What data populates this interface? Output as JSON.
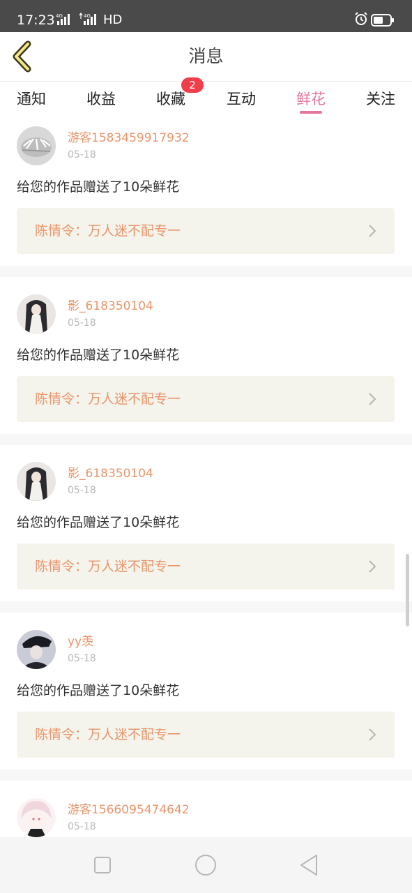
{
  "status_bar": {
    "time": "17:23",
    "network_1": "4G",
    "network_2": "4G",
    "hd": "HD",
    "icons": [
      "signal-icon",
      "signal-icon",
      "alarm-clock-icon",
      "battery-icon"
    ]
  },
  "header": {
    "title": "消息",
    "back_icon": "chevron-left-icon",
    "back_color": "#3a3a1a"
  },
  "tabs": [
    {
      "label": "通知",
      "active": false
    },
    {
      "label": "收益",
      "active": false
    },
    {
      "label": "收藏",
      "active": false,
      "badge": "2"
    },
    {
      "label": "互动",
      "active": false
    },
    {
      "label": "鲜花",
      "active": true
    },
    {
      "label": "关注",
      "active": false
    }
  ],
  "colors": {
    "accent": "#e4769e",
    "username": "#e9956b",
    "badge": "#f23e4a",
    "work_bg": "#f5f4ec"
  },
  "messages": [
    {
      "username": "游客1583459917932",
      "date": "05-18",
      "text": "给您的作品赠送了10朵鲜花",
      "work": "陈情令：万人迷不配专一"
    },
    {
      "username": "影_618350104",
      "date": "05-18",
      "text": "给您的作品赠送了10朵鲜花",
      "work": "陈情令：万人迷不配专一"
    },
    {
      "username": "影_618350104",
      "date": "05-18",
      "text": "给您的作品赠送了10朵鲜花",
      "work": "陈情令：万人迷不配专一"
    },
    {
      "username": "yy羡",
      "date": "05-18",
      "text": "给您的作品赠送了10朵鲜花",
      "work": "陈情令：万人迷不配专一"
    },
    {
      "username": "游客1566095474642",
      "date": "05-18"
    }
  ],
  "nav_bar": {
    "icons": [
      "square-recent-apps-icon",
      "circle-home-icon",
      "triangle-back-icon"
    ]
  }
}
